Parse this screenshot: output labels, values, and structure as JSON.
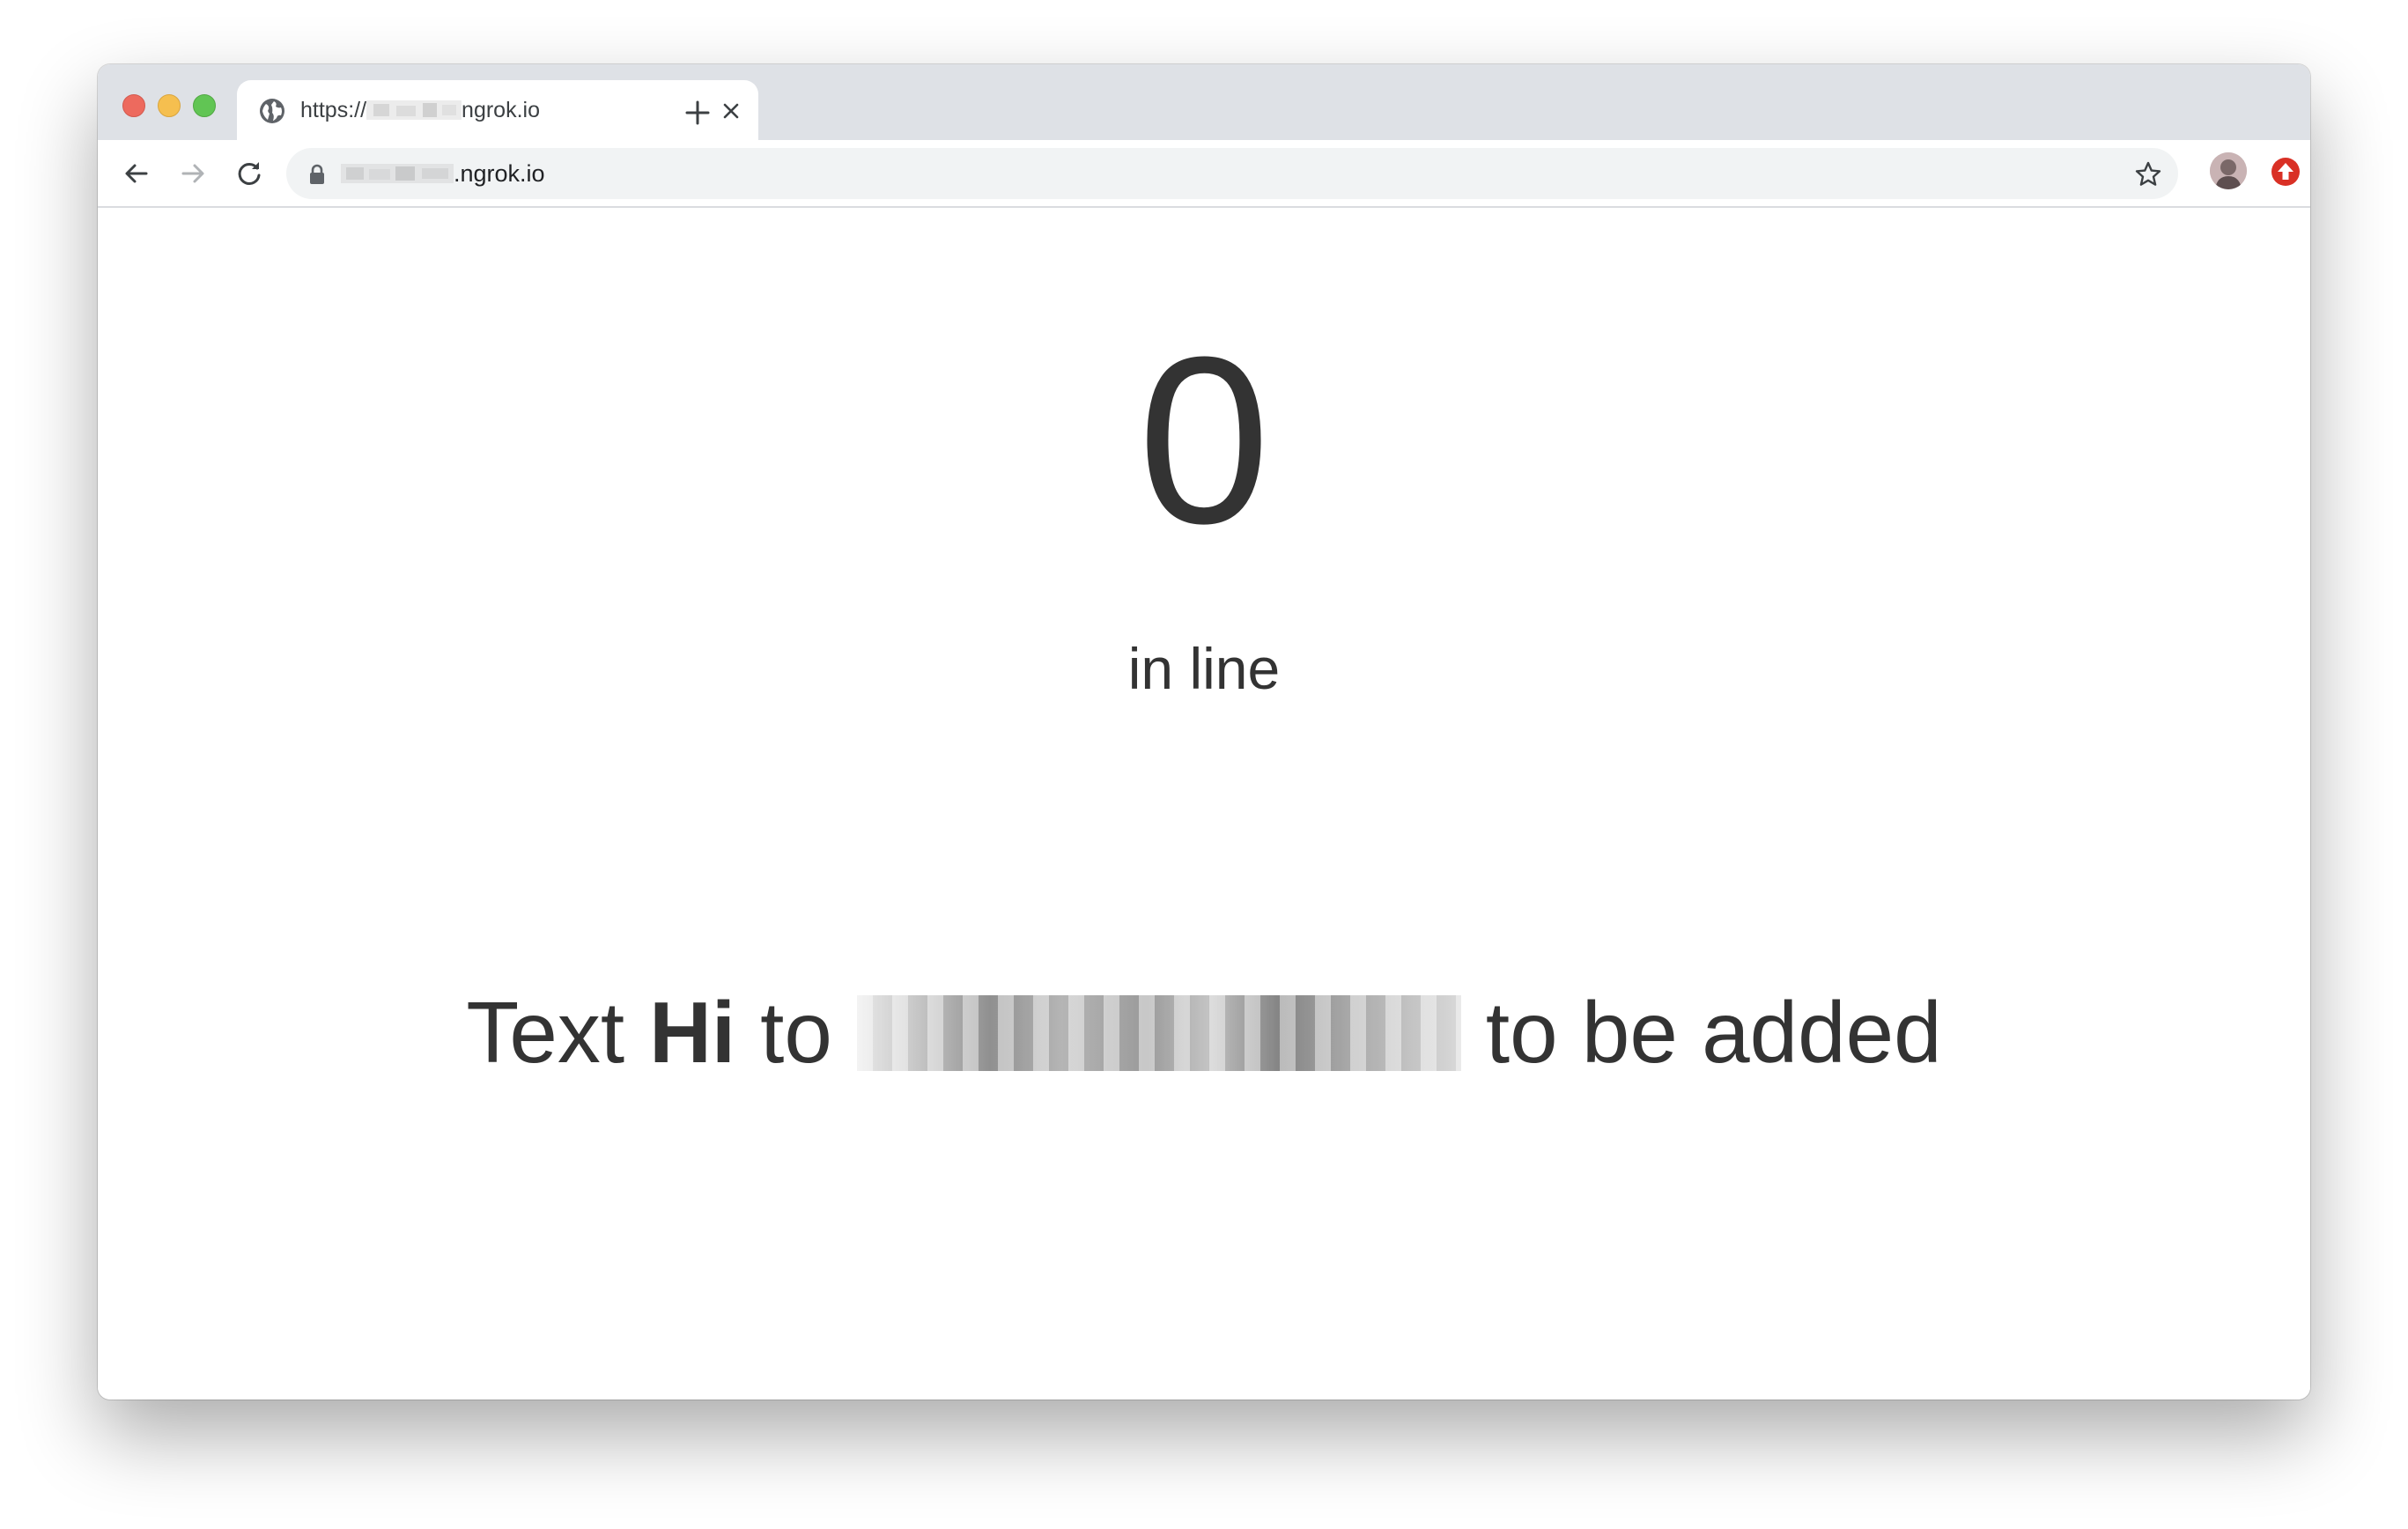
{
  "browser": {
    "tab": {
      "title_prefix": "https://",
      "title_suffix": "ngrok.io",
      "favicon": "globe-icon"
    },
    "address_bar": {
      "url_suffix": ".ngrok.io"
    },
    "icons": {
      "back": "arrow-left-icon",
      "forward": "arrow-right-icon",
      "reload": "reload-icon",
      "lock": "lock-icon",
      "bookmark": "star-icon",
      "extension": "upload-arrow-icon"
    }
  },
  "page": {
    "queue_count": "0",
    "queue_label": "in line",
    "instruction": {
      "prefix": "Text",
      "keyword": "Hi",
      "to": "to",
      "suffix": "to be added",
      "phone_number": "[redacted]"
    }
  },
  "colors": {
    "text": "#333333",
    "chrome_bg": "#dee1e6",
    "omnibox_bg": "#f1f3f4",
    "extension_red": "#d93025"
  }
}
